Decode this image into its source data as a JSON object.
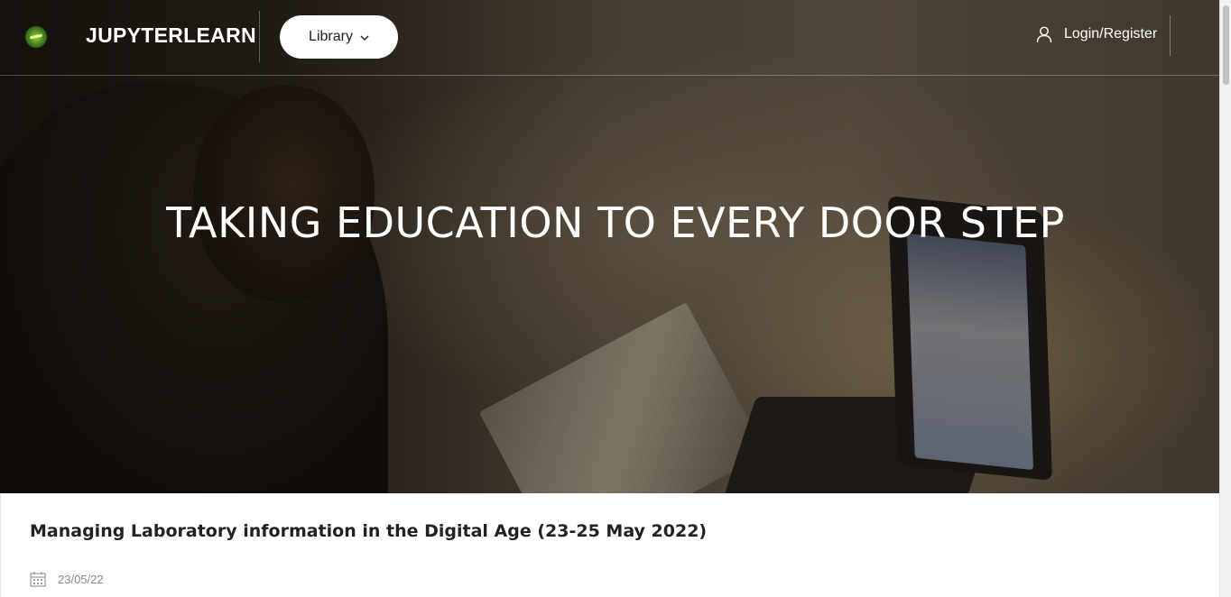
{
  "header": {
    "brand": "JUPYTERLEARN",
    "library_label": "Library",
    "login_label": "Login/Register"
  },
  "hero": {
    "title": "TAKING EDUCATION TO EVERY DOOR STEP"
  },
  "article": {
    "title": "Managing Laboratory information in the Digital Age (23-25 May 2022)",
    "date": "23/05/22"
  },
  "icons": {
    "logo": "jupyterlearn-logo-icon",
    "library_chevron": "chevron-down-icon",
    "login": "user-icon",
    "date": "calendar-icon"
  }
}
